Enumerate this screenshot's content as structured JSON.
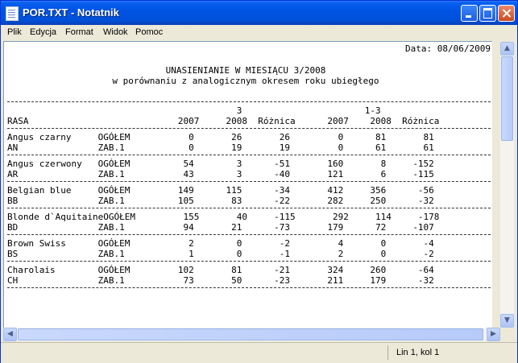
{
  "window": {
    "title": "POR.TXT - Notatnik"
  },
  "menu": [
    "Plik",
    "Edycja",
    "Format",
    "Widok",
    "Pomoc"
  ],
  "document": {
    "date_line": "Data: 08/06/2009",
    "title": "UNASIENIANIE W MIESIĄCU 3/2008",
    "subtitle": "w porównaniu z analogicznym okresem roku ubiegłego",
    "header_periods": {
      "month": "3",
      "range": "1-3"
    },
    "columns": [
      "RASA",
      "2007",
      "2008",
      "Różnica",
      "2007",
      "2008",
      "Różnica"
    ],
    "rows": [
      {
        "breed": "Angus czarny",
        "code": "AN",
        "a": [
          "OGÓŁEM",
          "0",
          "26",
          "26",
          "0",
          "81",
          "81"
        ],
        "b": [
          "ZAB.1",
          "0",
          "19",
          "19",
          "0",
          "61",
          "61"
        ]
      },
      {
        "breed": "Angus czerwony",
        "code": "AR",
        "a": [
          "OGÓŁEM",
          "54",
          "3",
          "-51",
          "160",
          "8",
          "-152"
        ],
        "b": [
          "ZAB.1",
          "43",
          "3",
          "-40",
          "121",
          "6",
          "-115"
        ]
      },
      {
        "breed": "Belgian blue",
        "code": "BB",
        "a": [
          "OGÓŁEM",
          "149",
          "115",
          "-34",
          "412",
          "356",
          "-56"
        ],
        "b": [
          "ZAB.1",
          "105",
          "83",
          "-22",
          "282",
          "250",
          "-32"
        ]
      },
      {
        "breed": "Blonde d`Aquitaine",
        "code": "BD",
        "a": [
          "OGÓŁEM",
          "155",
          "40",
          "-115",
          "292",
          "114",
          "-178"
        ],
        "b": [
          "ZAB.1",
          "94",
          "21",
          "-73",
          "179",
          "72",
          "-107"
        ]
      },
      {
        "breed": "Brown Swiss",
        "code": "BS",
        "a": [
          "OGÓŁEM",
          "2",
          "0",
          "-2",
          "4",
          "0",
          "-4"
        ],
        "b": [
          "ZAB.1",
          "1",
          "0",
          "-1",
          "2",
          "0",
          "-2"
        ]
      },
      {
        "breed": "Charolais",
        "code": "CH",
        "a": [
          "OGÓŁEM",
          "102",
          "81",
          "-21",
          "324",
          "260",
          "-64"
        ],
        "b": [
          "ZAB.1",
          "73",
          "50",
          "-23",
          "211",
          "179",
          "-32"
        ]
      }
    ]
  },
  "status": {
    "position": "Lin 1, kol 1"
  }
}
